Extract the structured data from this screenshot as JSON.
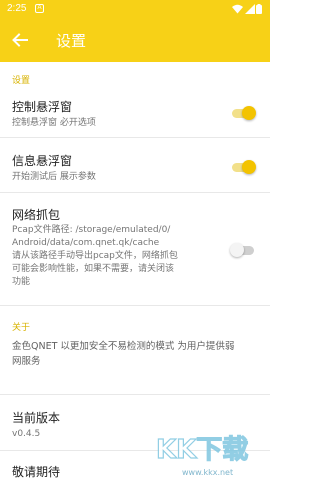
{
  "status_bar": {
    "time": "2:25",
    "notification_glyph": "A"
  },
  "app_bar": {
    "title": "设置"
  },
  "sections": {
    "settings_header": "设置",
    "about_header": "关于"
  },
  "items": {
    "control_float": {
      "title": "控制悬浮窗",
      "subtitle": "控制悬浮窗 必开选项",
      "enabled": true
    },
    "info_float": {
      "title": "信息悬浮窗",
      "subtitle": "开始测试后 展示参数",
      "enabled": true
    },
    "packet_capture": {
      "title": "网络抓包",
      "lines": [
        "Pcap文件路径: /storage/emulated/0/",
        "Android/data/com.qnet.qk/cache",
        "请从该路径手动导出pcap文件，网络抓包",
        "可能会影响性能，如果不需要，请关闭该",
        "功能"
      ],
      "enabled": false
    },
    "about_text": [
      "金色QNET 以更加安全不易检测的模式 为用户提供弱",
      "网服务"
    ],
    "version": {
      "title": "当前版本",
      "value": "v0.4.5"
    },
    "coming": {
      "title": "敬请期待"
    }
  },
  "watermark": {
    "text": "KK下载",
    "url": "www.kkx.net"
  },
  "colors": {
    "accent": "#f7d117",
    "section": "#d8b300"
  }
}
